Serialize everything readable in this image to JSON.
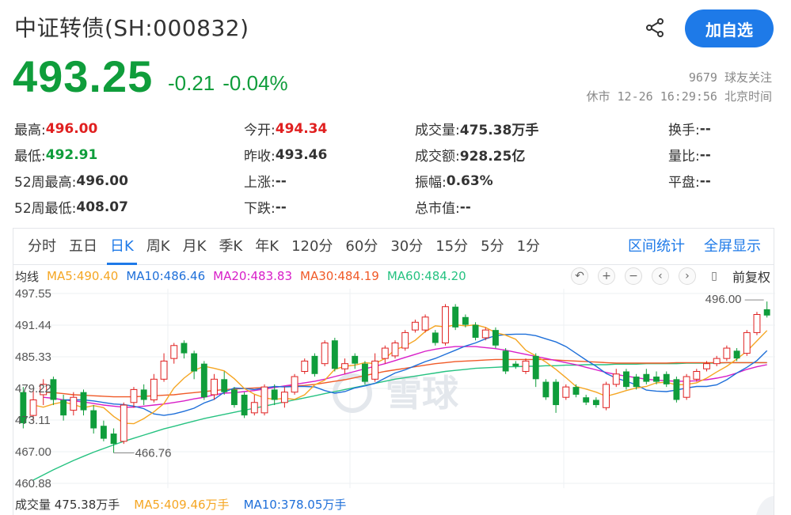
{
  "header": {
    "title": "中证转债(SH:000832)",
    "add_label": "加自选",
    "price": "493.25",
    "change": "-0.21",
    "change_pct": "-0.04%",
    "followers": "9679 球友关注",
    "status_time": "休市 12-26 16:29:56 北京时间"
  },
  "stats": {
    "high_lbl": "最高:",
    "high": "496.00",
    "open_lbl": "今开:",
    "open": "494.34",
    "vol_lbl": "成交量:",
    "vol": "475.38万手",
    "turnover_lbl": "换手:",
    "turnover": "--",
    "low_lbl": "最低:",
    "low": "492.91",
    "prev_lbl": "昨收:",
    "prev": "493.46",
    "amount_lbl": "成交额:",
    "amount": "928.25亿",
    "ratio_lbl": "量比:",
    "ratio": "--",
    "h52_lbl": "52周最高:",
    "h52": "496.00",
    "up_lbl": "上涨:",
    "up": "--",
    "amp_lbl": "振幅:",
    "amp": "0.63%",
    "flat_lbl": "平盘:",
    "flat": "--",
    "l52_lbl": "52周最低:",
    "l52": "408.07",
    "down_lbl": "下跌:",
    "down": "--",
    "mcap_lbl": "总市值:",
    "mcap": "--"
  },
  "tabs": [
    "分时",
    "五日",
    "日K",
    "周K",
    "月K",
    "季K",
    "年K",
    "120分",
    "60分",
    "30分",
    "15分",
    "5分",
    "1分"
  ],
  "active_tab": "日K",
  "tab_links": {
    "range_stats": "区间统计",
    "fullscreen": "全屏显示"
  },
  "ma": {
    "label": "均线",
    "ma5": "MA5:490.40",
    "ma10": "MA10:486.46",
    "ma20": "MA20:483.83",
    "ma30": "MA30:484.19",
    "ma60": "MA60:484.20",
    "fq": "前复权"
  },
  "volume_bar": {
    "vol": "成交量 475.38万手",
    "ma5": "MA5:409.46万手",
    "ma10": "MA10:378.05万手"
  },
  "watermark": "雪球",
  "colors": {
    "up": "#e02020",
    "down": "#0f9d3b",
    "accent": "#1e7ae8",
    "ma5": "#f5a623",
    "ma10": "#1e6fd9",
    "ma20": "#d81ec8",
    "ma30": "#f05a28",
    "ma60": "#26c281"
  },
  "icons": [
    "share-icon",
    "undo-icon",
    "zoom-in-icon",
    "zoom-out-icon",
    "chevron-left-icon",
    "chevron-right-icon",
    "pin-icon"
  ],
  "chart_data": {
    "type": "candlestick",
    "y_ticks": [
      "497.55",
      "491.44",
      "485.33",
      "479.22",
      "473.11",
      "467.00",
      "460.88"
    ],
    "ylim": [
      460.88,
      497.55
    ],
    "max_label": "496.00",
    "min_label": "466.76",
    "candles": [
      {
        "o": 478.5,
        "c": 472.5,
        "h": 479.5,
        "l": 471.5
      },
      {
        "o": 474,
        "c": 477,
        "h": 479,
        "l": 473
      },
      {
        "o": 478,
        "c": 480,
        "h": 481,
        "l": 476
      },
      {
        "o": 481,
        "c": 477,
        "h": 481.5,
        "l": 476
      },
      {
        "o": 477,
        "c": 474,
        "h": 478,
        "l": 473
      },
      {
        "o": 475,
        "c": 477.5,
        "h": 478.5,
        "l": 474
      },
      {
        "o": 478.5,
        "c": 475,
        "h": 479,
        "l": 474
      },
      {
        "o": 475,
        "c": 471.5,
        "h": 476,
        "l": 470.5
      },
      {
        "o": 472,
        "c": 469.5,
        "h": 473,
        "l": 469
      },
      {
        "o": 470.5,
        "c": 468.5,
        "h": 471.5,
        "l": 466.76
      },
      {
        "o": 469,
        "c": 476,
        "h": 476.5,
        "l": 468.5
      },
      {
        "o": 476.5,
        "c": 479,
        "h": 479.5,
        "l": 475.5
      },
      {
        "o": 479,
        "c": 477,
        "h": 480,
        "l": 476
      },
      {
        "o": 477,
        "c": 481,
        "h": 482,
        "l": 476.5
      },
      {
        "o": 481,
        "c": 484.5,
        "h": 486,
        "l": 480.5
      },
      {
        "o": 485,
        "c": 487.5,
        "h": 488,
        "l": 484
      },
      {
        "o": 488,
        "c": 486,
        "h": 488.5,
        "l": 485
      },
      {
        "o": 486,
        "c": 482.5,
        "h": 486.5,
        "l": 481
      },
      {
        "o": 484,
        "c": 477.5,
        "h": 484.5,
        "l": 477
      },
      {
        "o": 478,
        "c": 481,
        "h": 482,
        "l": 477
      },
      {
        "o": 481,
        "c": 478.5,
        "h": 482.5,
        "l": 478
      },
      {
        "o": 479,
        "c": 476,
        "h": 479.5,
        "l": 475.5
      },
      {
        "o": 478,
        "c": 474,
        "h": 478.5,
        "l": 473.5
      },
      {
        "o": 474.5,
        "c": 476.5,
        "h": 478,
        "l": 474
      },
      {
        "o": 474.5,
        "c": 479.5,
        "h": 480,
        "l": 474
      },
      {
        "o": 479,
        "c": 477,
        "h": 480,
        "l": 476
      },
      {
        "o": 476.5,
        "c": 478.5,
        "h": 479.5,
        "l": 475.5
      },
      {
        "o": 478.5,
        "c": 481.5,
        "h": 482,
        "l": 478
      },
      {
        "o": 482.5,
        "c": 484.5,
        "h": 485,
        "l": 482
      },
      {
        "o": 485.5,
        "c": 482,
        "h": 486,
        "l": 481.5
      },
      {
        "o": 484,
        "c": 488,
        "h": 488.5,
        "l": 483.5
      },
      {
        "o": 488.5,
        "c": 483,
        "h": 489,
        "l": 482.5
      },
      {
        "o": 483,
        "c": 484,
        "h": 485,
        "l": 482
      },
      {
        "o": 485.5,
        "c": 484,
        "h": 486,
        "l": 483
      },
      {
        "o": 484,
        "c": 480.5,
        "h": 484.5,
        "l": 480
      },
      {
        "o": 481,
        "c": 484.5,
        "h": 486,
        "l": 480.5
      },
      {
        "o": 485,
        "c": 487,
        "h": 487.5,
        "l": 484
      },
      {
        "o": 485.5,
        "c": 488,
        "h": 488.5,
        "l": 485
      },
      {
        "o": 487,
        "c": 490,
        "h": 490.5,
        "l": 486.5
      },
      {
        "o": 490.5,
        "c": 492,
        "h": 492.5,
        "l": 490
      },
      {
        "o": 490.5,
        "c": 493,
        "h": 493.5,
        "l": 490
      },
      {
        "o": 490,
        "c": 488,
        "h": 490.5,
        "l": 487.5
      },
      {
        "o": 488,
        "c": 495,
        "h": 495.5,
        "l": 487.5
      },
      {
        "o": 495,
        "c": 491,
        "h": 495.5,
        "l": 490.5
      },
      {
        "o": 493,
        "c": 491.5,
        "h": 493.5,
        "l": 491
      },
      {
        "o": 491.5,
        "c": 489,
        "h": 492,
        "l": 488.5
      },
      {
        "o": 489,
        "c": 490.5,
        "h": 491,
        "l": 488.5
      },
      {
        "o": 490.5,
        "c": 487.5,
        "h": 491,
        "l": 487
      },
      {
        "o": 486.5,
        "c": 482.5,
        "h": 487,
        "l": 482
      },
      {
        "o": 484,
        "c": 483.5,
        "h": 484.5,
        "l": 483
      },
      {
        "o": 482.5,
        "c": 484.5,
        "h": 485,
        "l": 482
      },
      {
        "o": 485.5,
        "c": 481,
        "h": 486,
        "l": 479.5
      },
      {
        "o": 480.5,
        "c": 477.5,
        "h": 481,
        "l": 477
      },
      {
        "o": 480.5,
        "c": 476,
        "h": 481,
        "l": 474.5
      },
      {
        "o": 477.5,
        "c": 479.5,
        "h": 480,
        "l": 477
      },
      {
        "o": 479.5,
        "c": 478,
        "h": 480,
        "l": 477.5
      },
      {
        "o": 477.5,
        "c": 476.5,
        "h": 478,
        "l": 476
      },
      {
        "o": 477,
        "c": 476,
        "h": 477.5,
        "l": 475.5
      },
      {
        "o": 475.5,
        "c": 480,
        "h": 480.5,
        "l": 475
      },
      {
        "o": 480,
        "c": 482,
        "h": 483,
        "l": 479.5
      },
      {
        "o": 482.5,
        "c": 479.5,
        "h": 483,
        "l": 479
      },
      {
        "o": 481.5,
        "c": 479.5,
        "h": 482,
        "l": 479
      },
      {
        "o": 482,
        "c": 480.5,
        "h": 483,
        "l": 480
      },
      {
        "o": 481.5,
        "c": 480.5,
        "h": 482.5,
        "l": 480
      },
      {
        "o": 482,
        "c": 480,
        "h": 482.5,
        "l": 479.5
      },
      {
        "o": 481,
        "c": 477,
        "h": 481.5,
        "l": 476.5
      },
      {
        "o": 477.5,
        "c": 481.5,
        "h": 482,
        "l": 477
      },
      {
        "o": 481,
        "c": 482.5,
        "h": 483,
        "l": 480.5
      },
      {
        "o": 483,
        "c": 484,
        "h": 484.5,
        "l": 482.5
      },
      {
        "o": 484,
        "c": 485,
        "h": 485.5,
        "l": 483.5
      },
      {
        "o": 485,
        "c": 487,
        "h": 487.5,
        "l": 484.5
      },
      {
        "o": 486.5,
        "c": 485,
        "h": 487,
        "l": 484.5
      },
      {
        "o": 486,
        "c": 490,
        "h": 490.5,
        "l": 485.5
      },
      {
        "o": 490,
        "c": 493.5,
        "h": 494,
        "l": 489.5
      },
      {
        "o": 494.5,
        "c": 493.3,
        "h": 496,
        "l": 492.91
      }
    ],
    "ma5": [
      476,
      475.6,
      476.2,
      476.6,
      476.1,
      475.5,
      475.9,
      475.5,
      473.8,
      472.5,
      472.4,
      473.4,
      474.7,
      476.3,
      479.3,
      481.2,
      482.7,
      483.5,
      483.1,
      482.6,
      481.1,
      479.2,
      478.1,
      477.4,
      477.1,
      477.3,
      477.1,
      478,
      479.9,
      480.8,
      482.9,
      483.5,
      483.7,
      484.2,
      484,
      485,
      486.7,
      487.4,
      488.5,
      490.2,
      491.3,
      491.1,
      491.5,
      491.3,
      491.5,
      491,
      490,
      489.5,
      488.7,
      486.6,
      485.5,
      484.3,
      482.9,
      481.3,
      479.6,
      479.1,
      478.5,
      477.7,
      478.2,
      478.8,
      479.3,
      479.6,
      480.3,
      480.4,
      479.9,
      480,
      480.3,
      481.2,
      482.4,
      483.5,
      484.9,
      486.4,
      488.4,
      490.4
    ],
    "ma10": [
      477,
      477,
      477,
      476.8,
      476.5,
      476.2,
      476.1,
      475.8,
      475.3,
      474.3,
      474,
      474.3,
      474.8,
      475.4,
      476.4,
      477.1,
      478.5,
      479.3,
      479.2,
      479,
      479.3,
      479.6,
      479.5,
      479.6,
      479.6,
      479.5,
      478.8,
      478.3,
      478.6,
      479.3,
      479.7,
      480.2,
      481.2,
      482.2,
      482.8,
      483.6,
      484.4,
      485,
      485.8,
      486.6,
      487.4,
      488,
      488.8,
      489.4,
      489.6,
      489.7,
      489.7,
      489.4,
      488.8,
      488.2,
      487.3,
      486,
      484.7,
      483.5,
      482.1,
      481.2,
      480.6,
      479.9,
      478.9,
      478.7,
      478.6,
      478.9,
      479.3,
      479.6,
      479.6,
      479.9,
      480.9,
      482.2,
      483.3,
      484.6,
      486.5
    ],
    "ma20": [
      477.5,
      477.3,
      477,
      476.8,
      476.6,
      476.3,
      476,
      475.8,
      475.6,
      475.6,
      475.8,
      476,
      476.2,
      476.5,
      476.8,
      477.2,
      477.5,
      478,
      478.3,
      478.4,
      478.6,
      478.8,
      479.1,
      479.4,
      479.7,
      480,
      480.3,
      480.6,
      481,
      481.5,
      482,
      482.5,
      483,
      483.5,
      484,
      484.6,
      485.2,
      485.8,
      486.4,
      486.8,
      487.1,
      487.3,
      487.3,
      487.3,
      487.1,
      486.9,
      486.6,
      486.2,
      485.8,
      485.4,
      485,
      484.6,
      484.2,
      483.8,
      483.3,
      482.8,
      482.3,
      481.9,
      481.6,
      481.3,
      481,
      480.8,
      480.7,
      480.6,
      480.6,
      480.7,
      480.9,
      481.2,
      481.6,
      482.2,
      482.9,
      483.4,
      483.8
    ],
    "ma30": [
      478.5,
      478.4,
      478.2,
      478,
      477.9,
      477.8,
      477.7,
      477.6,
      477.6,
      477.6,
      477.7,
      477.8,
      477.9,
      478,
      478.2,
      478.4,
      478.6,
      478.8,
      479,
      479.1,
      479.2,
      479.3,
      479.4,
      479.5,
      479.6,
      479.7,
      479.8,
      480,
      480.3,
      480.6,
      480.9,
      481.3,
      481.7,
      482.1,
      482.5,
      482.8,
      483.1,
      483.4,
      483.7,
      484,
      484.2,
      484.4,
      484.5,
      484.6,
      484.7,
      484.8,
      484.8,
      484.8,
      484.8,
      484.8,
      484.8,
      484.7,
      484.6,
      484.5,
      484.4,
      484.3,
      484.2,
      484.1,
      484.1,
      484.1,
      484.1,
      484.1,
      484.1,
      484.2,
      484.2,
      484.2,
      484.2,
      484.2,
      484.2,
      484.2,
      484.2,
      484.2,
      484.19
    ],
    "ma60": [
      461.5,
      462.5,
      463.5,
      464.4,
      465.3,
      466.1,
      466.9,
      467.6,
      468.3,
      469,
      469.6,
      470.2,
      470.8,
      471.4,
      471.9,
      472.4,
      472.9,
      473.4,
      473.8,
      474.2,
      474.6,
      475,
      475.4,
      475.8,
      476.2,
      476.6,
      477,
      477.4,
      477.8,
      478.2,
      478.6,
      479,
      479.4,
      479.8,
      480.2,
      480.6,
      481,
      481.3,
      481.6,
      481.9,
      482.2,
      482.5,
      482.7,
      482.9,
      483.1,
      483.2,
      483.3,
      483.4,
      483.4,
      483.5,
      483.5,
      483.6,
      483.6,
      483.7,
      483.7,
      483.8,
      483.8,
      483.8,
      483.9,
      483.9,
      483.9,
      484,
      484,
      484,
      484,
      484.1,
      484.1,
      484.1,
      484.1,
      484.2,
      484.2,
      484.2,
      484.2,
      484.2
    ]
  }
}
